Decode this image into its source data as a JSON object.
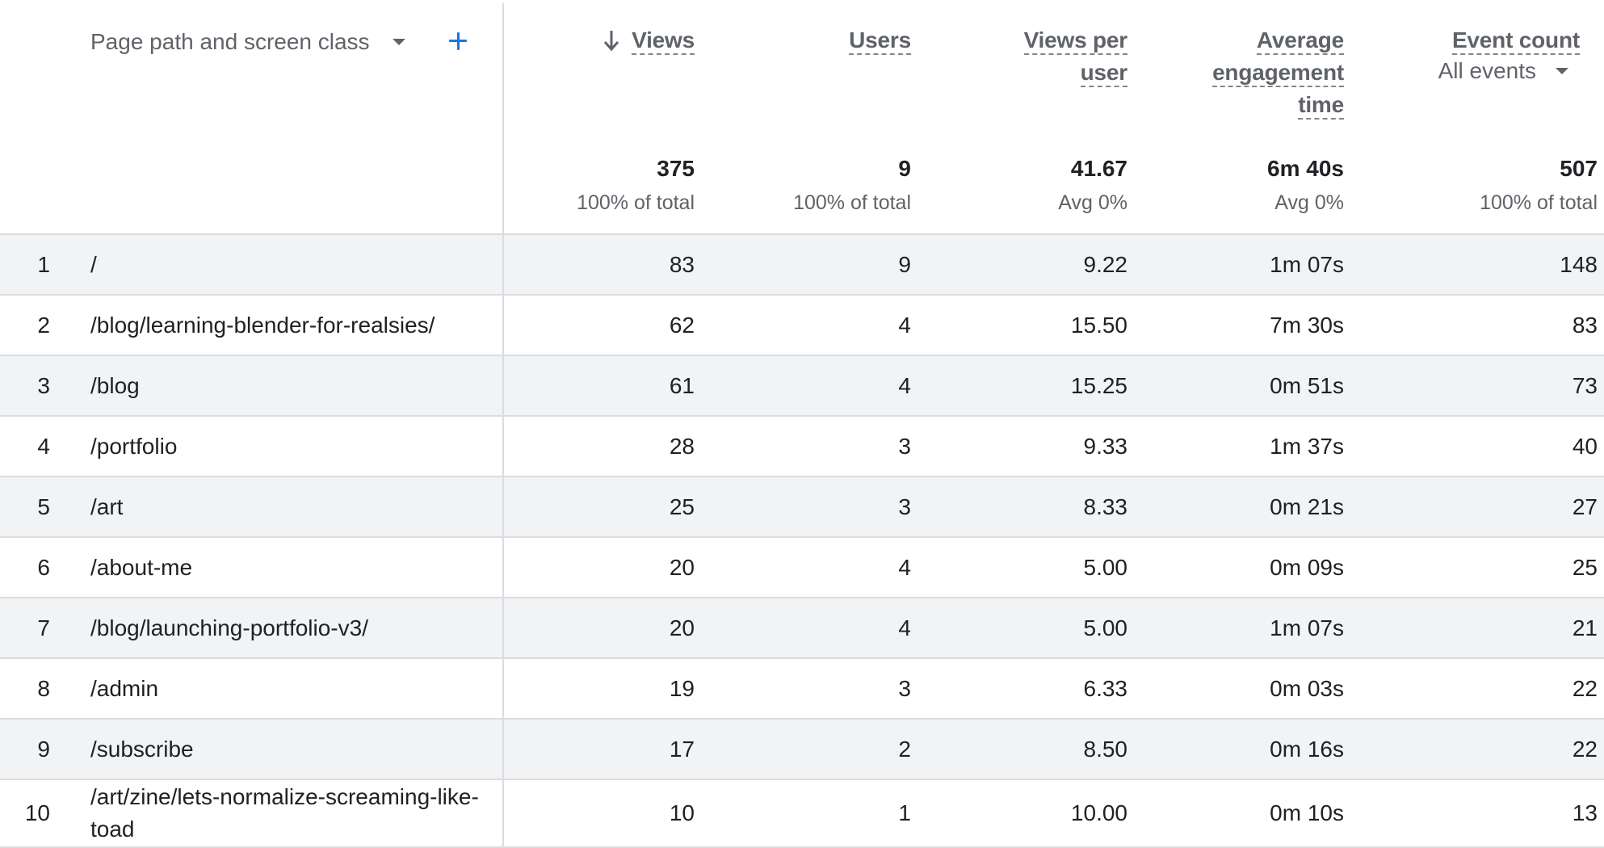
{
  "dimension": {
    "label": "Page path and screen class"
  },
  "metrics": {
    "views": {
      "title": "Views",
      "total": "375",
      "total_sub": "100% of total"
    },
    "users": {
      "title": "Users",
      "total": "9",
      "total_sub": "100% of total"
    },
    "views_per_user": {
      "title_line1": "Views per",
      "title_line2": "user",
      "total": "41.67",
      "total_sub": "Avg 0%"
    },
    "avg_engagement": {
      "title_line1": "Average",
      "title_line2": "engagement",
      "title_line3": "time",
      "total": "6m 40s",
      "total_sub": "Avg 0%"
    },
    "event_count": {
      "title": "Event count",
      "selector": "All events",
      "total": "507",
      "total_sub": "100% of total"
    }
  },
  "rows": [
    {
      "index": "1",
      "path": "/",
      "views": "83",
      "users": "9",
      "vpu": "9.22",
      "aet": "1m 07s",
      "events": "148"
    },
    {
      "index": "2",
      "path": "/blog/learning-blender-for-realsies/",
      "views": "62",
      "users": "4",
      "vpu": "15.50",
      "aet": "7m 30s",
      "events": "83"
    },
    {
      "index": "3",
      "path": "/blog",
      "views": "61",
      "users": "4",
      "vpu": "15.25",
      "aet": "0m 51s",
      "events": "73"
    },
    {
      "index": "4",
      "path": "/portfolio",
      "views": "28",
      "users": "3",
      "vpu": "9.33",
      "aet": "1m 37s",
      "events": "40"
    },
    {
      "index": "5",
      "path": "/art",
      "views": "25",
      "users": "3",
      "vpu": "8.33",
      "aet": "0m 21s",
      "events": "27"
    },
    {
      "index": "6",
      "path": "/about-me",
      "views": "20",
      "users": "4",
      "vpu": "5.00",
      "aet": "0m 09s",
      "events": "25"
    },
    {
      "index": "7",
      "path": "/blog/launching-portfolio-v3/",
      "views": "20",
      "users": "4",
      "vpu": "5.00",
      "aet": "1m 07s",
      "events": "21"
    },
    {
      "index": "8",
      "path": "/admin",
      "views": "19",
      "users": "3",
      "vpu": "6.33",
      "aet": "0m 03s",
      "events": "22"
    },
    {
      "index": "9",
      "path": "/subscribe",
      "views": "17",
      "users": "2",
      "vpu": "8.50",
      "aet": "0m 16s",
      "events": "22"
    },
    {
      "index": "10",
      "path": "/art/zine/lets-normalize-screaming-like-toad",
      "views": "10",
      "users": "1",
      "vpu": "10.00",
      "aet": "0m 10s",
      "events": "13"
    }
  ],
  "colors": {
    "accent": "#1a73e8",
    "row_shade": "#f1f3f4",
    "border": "#dadce0",
    "muted_text": "#5f6368"
  },
  "icons": {
    "sort": "arrow-down-icon",
    "dropdown": "caret-down-icon",
    "add": "plus-icon"
  }
}
